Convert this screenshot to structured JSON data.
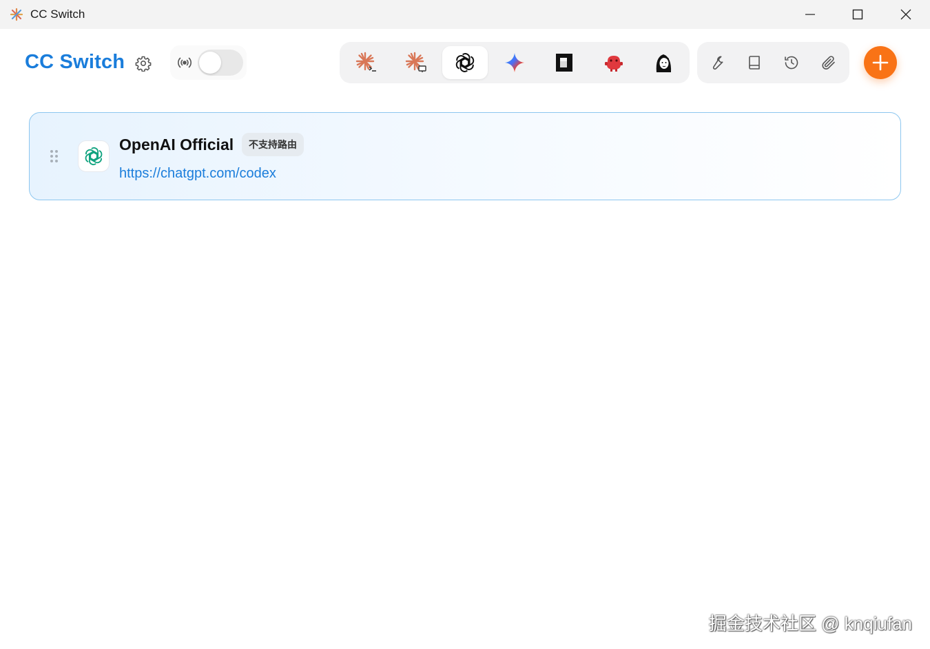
{
  "window": {
    "title": "CC Switch",
    "controls": [
      "minimize",
      "maximize",
      "close"
    ]
  },
  "header": {
    "brand": "CC Switch",
    "settings_icon": "gear-icon",
    "proxy_icon": "broadcast-icon",
    "proxy_toggle": {
      "enabled": false
    }
  },
  "app_tabs": [
    {
      "icon": "claude-code-icon",
      "active": false
    },
    {
      "icon": "claude-desktop-icon",
      "active": false
    },
    {
      "icon": "openai-icon",
      "active": true
    },
    {
      "icon": "gemini-icon",
      "active": false
    },
    {
      "icon": "terminal-app-icon",
      "active": false
    },
    {
      "icon": "red-robot-icon",
      "active": false
    },
    {
      "icon": "girl-avatar-icon",
      "active": false
    }
  ],
  "actions": [
    {
      "icon": "wrench-icon"
    },
    {
      "icon": "book-icon"
    },
    {
      "icon": "history-icon"
    },
    {
      "icon": "paperclip-icon"
    }
  ],
  "add_icon": "plus-icon",
  "colors": {
    "accent": "#1a7ddb",
    "add_button": "#f97316",
    "card_border": "#8cc6ef",
    "openai_green": "#10a37f"
  },
  "providers": [
    {
      "name": "OpenAI Official",
      "badge": "不支持路由",
      "url": "https://chatgpt.com/codex",
      "icon": "openai-icon",
      "selected": true
    }
  ],
  "watermark": "掘金技术社区 @ knqiufan"
}
